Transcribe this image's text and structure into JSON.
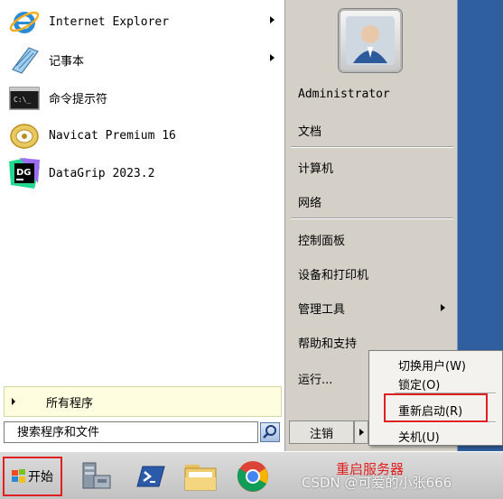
{
  "left_programs": [
    {
      "label": "Internet Explorer",
      "icon": "ie-icon",
      "has_submenu": true
    },
    {
      "label": "记事本",
      "icon": "notepad-icon",
      "has_submenu": true
    },
    {
      "label": "命令提示符",
      "icon": "cmd-icon",
      "has_submenu": false
    },
    {
      "label": "Navicat Premium 16",
      "icon": "navicat-icon",
      "has_submenu": false
    },
    {
      "label": "DataGrip 2023.2",
      "icon": "datagrip-icon",
      "has_submenu": false
    }
  ],
  "all_programs": "所有程序",
  "search": {
    "placeholder": "搜索程序和文件"
  },
  "right_pane": {
    "user": "Administrator",
    "items": [
      "文档",
      "计算机",
      "网络",
      "控制面板",
      "设备和打印机",
      "管理工具",
      "帮助和支持",
      "运行..."
    ]
  },
  "logoff_label": "注销",
  "shutdown_submenu": [
    "切换用户(W)",
    "锁定(O)",
    "重新启动(R)",
    "关机(U)"
  ],
  "taskbar": {
    "start_label": "开始",
    "icons": [
      "server-manager-icon",
      "powershell-icon",
      "explorer-folder-icon",
      "chrome-icon"
    ]
  },
  "annotation": "重启服务器",
  "watermark": "CSDN @可爱的小张666",
  "colors": {
    "highlight_red": "#e02020",
    "desktop_blue": "#3c6aa8"
  }
}
